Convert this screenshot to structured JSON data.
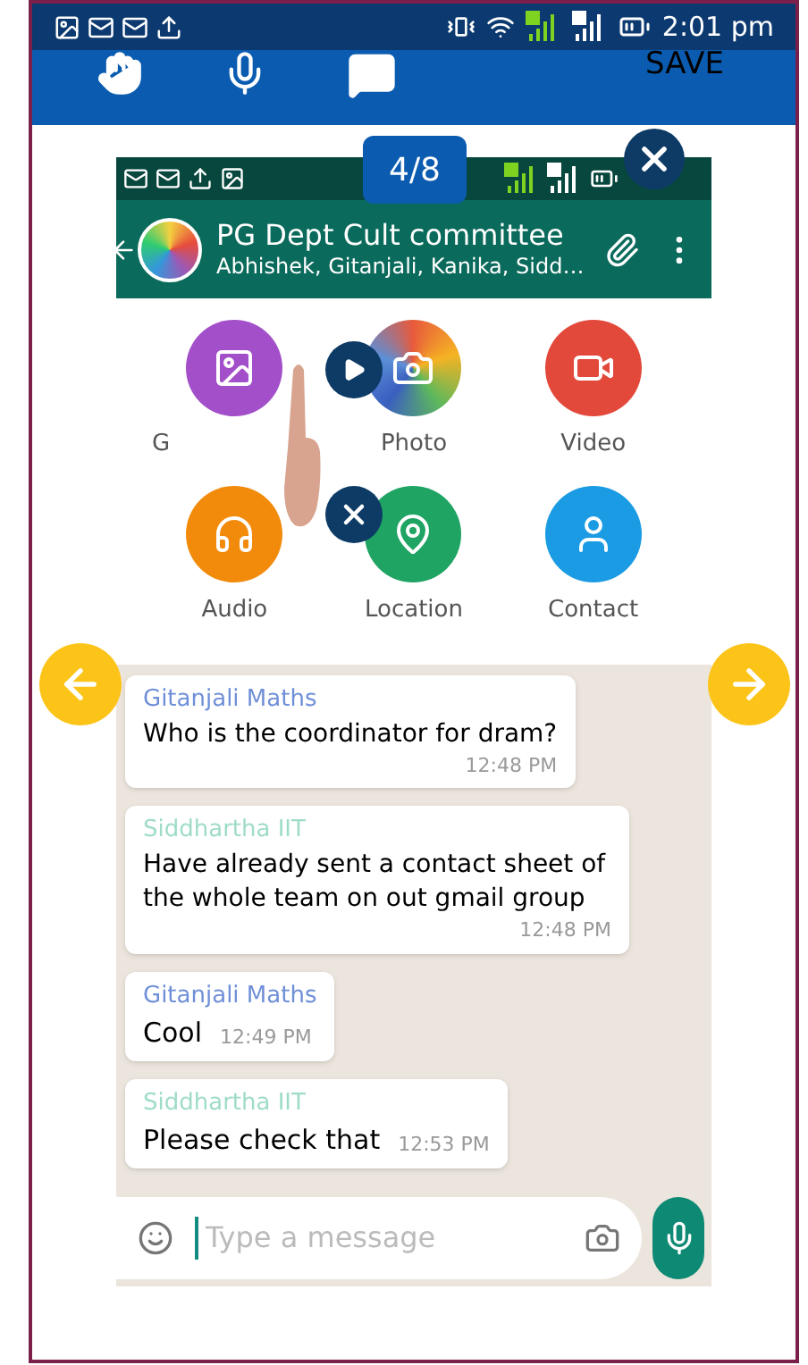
{
  "status_bar": {
    "time": "2:01 pm"
  },
  "toolbar": {
    "action": "SAVE"
  },
  "counter": "4/8",
  "chat": {
    "title": "PG Dept Cult committee",
    "subtitle": "Abhishek, Gitanjali, Kanika, Sidd…"
  },
  "attach_menu": [
    {
      "kind": "gallery",
      "label": "G"
    },
    {
      "kind": "photo",
      "label": "Photo"
    },
    {
      "kind": "video",
      "label": "Video"
    },
    {
      "kind": "audio",
      "label": "Audio"
    },
    {
      "kind": "location",
      "label": "Location"
    },
    {
      "kind": "contact",
      "label": "Contact"
    }
  ],
  "messages": [
    {
      "sender": "Gitanjali Maths",
      "color": "#6f8fd8",
      "text": "Who is the coordinator for dram?",
      "time": "12:48 PM",
      "kind": "block"
    },
    {
      "sender": "Siddhartha IIT",
      "color": "#9fdcc6",
      "text": "Have already sent a contact sheet of the whole team on out gmail group",
      "time": "12:48 PM",
      "kind": "block"
    },
    {
      "sender": "Gitanjali Maths",
      "color": "#6f8fd8",
      "text": "Cool",
      "time": "12:49 PM",
      "kind": "inline"
    },
    {
      "sender": "Siddhartha IIT",
      "color": "#9fdcc6",
      "text": "Please check that",
      "time": "12:53 PM",
      "kind": "inline"
    }
  ],
  "input": {
    "placeholder": "Type a message"
  }
}
